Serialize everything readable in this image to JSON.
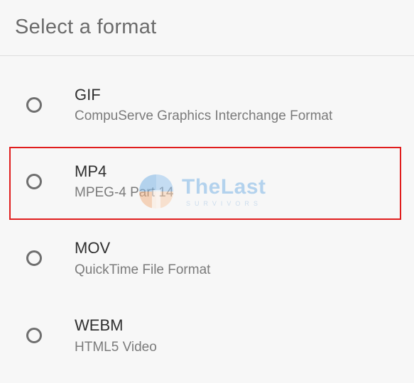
{
  "dialog": {
    "title": "Select a format"
  },
  "options": [
    {
      "title": "GIF",
      "subtitle": "CompuServe Graphics Interchange Format",
      "selected": false
    },
    {
      "title": "MP4",
      "subtitle": "MPEG-4 Part 14",
      "selected": false
    },
    {
      "title": "MOV",
      "subtitle": "QuickTime File Format",
      "selected": false
    },
    {
      "title": "WEBM",
      "subtitle": "HTML5 Video",
      "selected": false
    }
  ],
  "watermark": {
    "brand": "TheLast",
    "tagline": "SURVIVORS"
  },
  "colors": {
    "highlight": "#e01d1d",
    "radio": "#6f6f6f",
    "background": "#f7f7f7"
  }
}
